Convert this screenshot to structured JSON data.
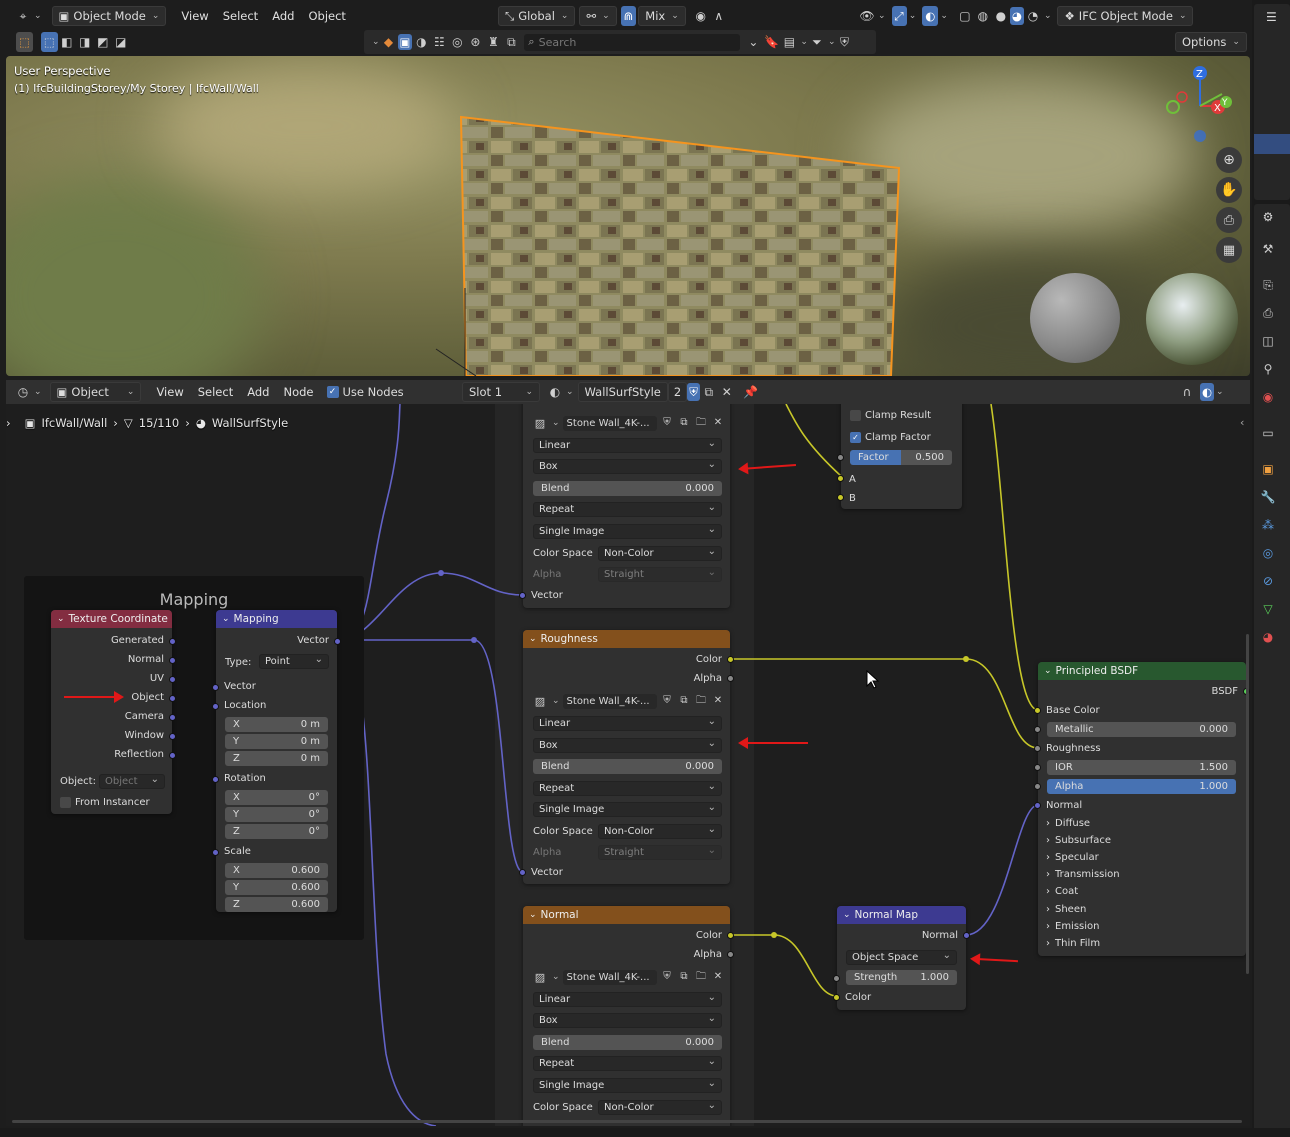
{
  "viewport_header": {
    "mode": "Object Mode",
    "menus": [
      "View",
      "Select",
      "Add",
      "Object"
    ],
    "orientation": "Global",
    "pivot": "Mix",
    "ifc_mode": "IFC Object Mode",
    "options": "Options",
    "search_placeholder": "Search",
    "overlay_title": "User Perspective",
    "overlay_path": "(1) IfcBuildingStorey/My Storey | IfcWall/Wall",
    "gizmo": {
      "z": "Z",
      "y": "Y",
      "x": "X"
    }
  },
  "node_header": {
    "editor_type": "Object",
    "menus": [
      "View",
      "Select",
      "Add",
      "Node"
    ],
    "use_nodes": "Use Nodes",
    "slot": "Slot 1",
    "material": "WallSurfStyle",
    "users": "2",
    "breadcrumb": {
      "object": "IfcWall/Wall",
      "mesh": "15/110",
      "material": "WallSurfStyle"
    }
  },
  "frame": {
    "title": "Mapping"
  },
  "texcoord": {
    "title": "Texture Coordinate",
    "outputs": [
      "Generated",
      "Normal",
      "UV",
      "Object",
      "Camera",
      "Window",
      "Reflection"
    ],
    "object_label": "Object:",
    "object_placeholder": "Object",
    "from_instancer": "From Instancer"
  },
  "mapping": {
    "title": "Mapping",
    "output": "Vector",
    "type_label": "Type:",
    "type_value": "Point",
    "vector": "Vector",
    "location": "Location",
    "rotation": "Rotation",
    "scale": "Scale",
    "loc": [
      {
        "a": "X",
        "v": "0 m"
      },
      {
        "a": "Y",
        "v": "0 m"
      },
      {
        "a": "Z",
        "v": "0 m"
      }
    ],
    "rot": [
      {
        "a": "X",
        "v": "0°"
      },
      {
        "a": "Y",
        "v": "0°"
      },
      {
        "a": "Z",
        "v": "0°"
      }
    ],
    "scl": [
      {
        "a": "X",
        "v": "0.600"
      },
      {
        "a": "Y",
        "v": "0.600"
      },
      {
        "a": "Z",
        "v": "0.600"
      }
    ]
  },
  "image_nodes": {
    "image_name": "Stone Wall_4K-...",
    "interp": "Linear",
    "projection": "Box",
    "blend_label": "Blend",
    "blend_value": "0.000",
    "extension": "Repeat",
    "source": "Single Image",
    "cs_label": "Color Space",
    "cs_value": "Non-Color",
    "alpha_label": "Alpha",
    "alpha_value": "Straight",
    "vector": "Vector",
    "color": "Color",
    "alpha": "Alpha",
    "roughness_title": "Roughness",
    "normal_title": "Normal"
  },
  "mix": {
    "clamp_result": "Clamp Result",
    "clamp_factor": "Clamp Factor",
    "factor_label": "Factor",
    "factor_value": "0.500",
    "a": "A",
    "b": "B"
  },
  "normal_map": {
    "title": "Normal Map",
    "output": "Normal",
    "space": "Object Space",
    "strength_label": "Strength",
    "strength_value": "1.000",
    "color": "Color"
  },
  "bsdf": {
    "title": "Principled BSDF",
    "output": "BSDF",
    "base_color": "Base Color",
    "metallic_label": "Metallic",
    "metallic_value": "0.000",
    "roughness": "Roughness",
    "ior_label": "IOR",
    "ior_value": "1.500",
    "alpha_label": "Alpha",
    "alpha_value": "1.000",
    "normal": "Normal",
    "panels": [
      "Diffuse",
      "Subsurface",
      "Specular",
      "Transmission",
      "Coat",
      "Sheen",
      "Emission",
      "Thin Film"
    ]
  },
  "colors": {
    "accent": "#4772b3",
    "selection": "#f5941e",
    "texture_header": "#83501c",
    "shader_header": "#28582f",
    "vector_header": "#3d3a91",
    "input_header": "#832d41",
    "arrow": "#e01818"
  }
}
